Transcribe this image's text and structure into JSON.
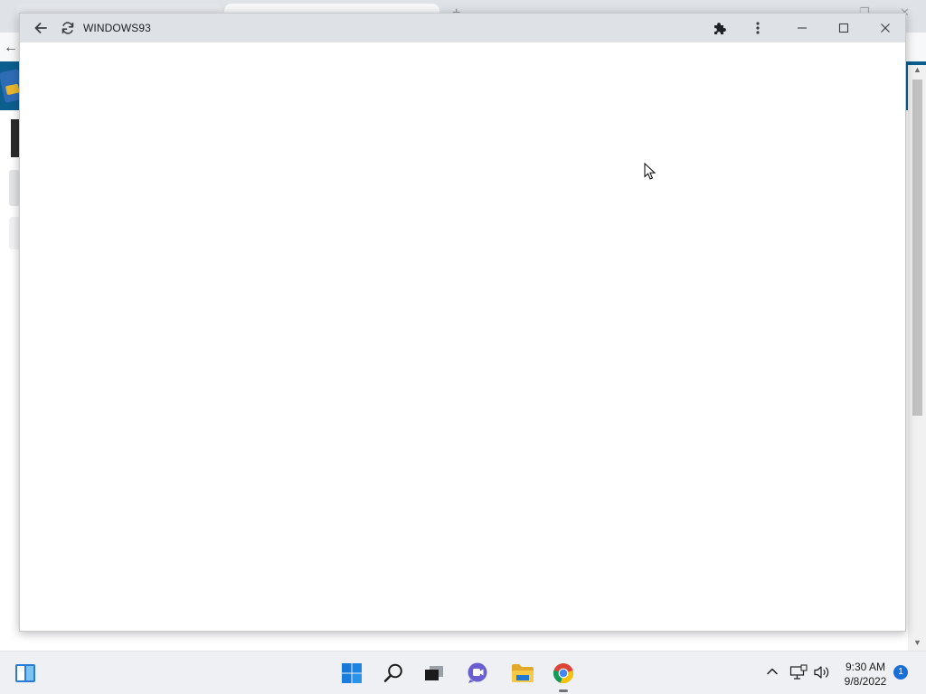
{
  "app_window": {
    "title": "WINDOWS93",
    "icons": {
      "back": "arrow-left-icon",
      "reload": "reload-icon",
      "extensions": "puzzle-piece-icon",
      "menu": "kebab-menu-icon",
      "minimize": "minimize-icon",
      "maximize": "maximize-icon",
      "close": "close-icon"
    }
  },
  "taskbar": {
    "icons": {
      "widgets": "widgets-icon",
      "start": "windows-start-icon",
      "search": "search-icon",
      "task_view": "task-view-icon",
      "chat": "teams-chat-icon",
      "file_explorer": "folder-icon",
      "chrome": "chrome-icon"
    },
    "tray": {
      "chevron": "chevron-up-icon",
      "network": "network-icon",
      "volume": "speaker-icon"
    },
    "time": "9:30 AM",
    "date": "9/8/2022",
    "notification_count": "1"
  },
  "colors": {
    "titlebar": "#dee1e6",
    "taskbar": "#eef0f3",
    "accent": "#1a6fd6",
    "bg_header": "#0c5e8e"
  }
}
